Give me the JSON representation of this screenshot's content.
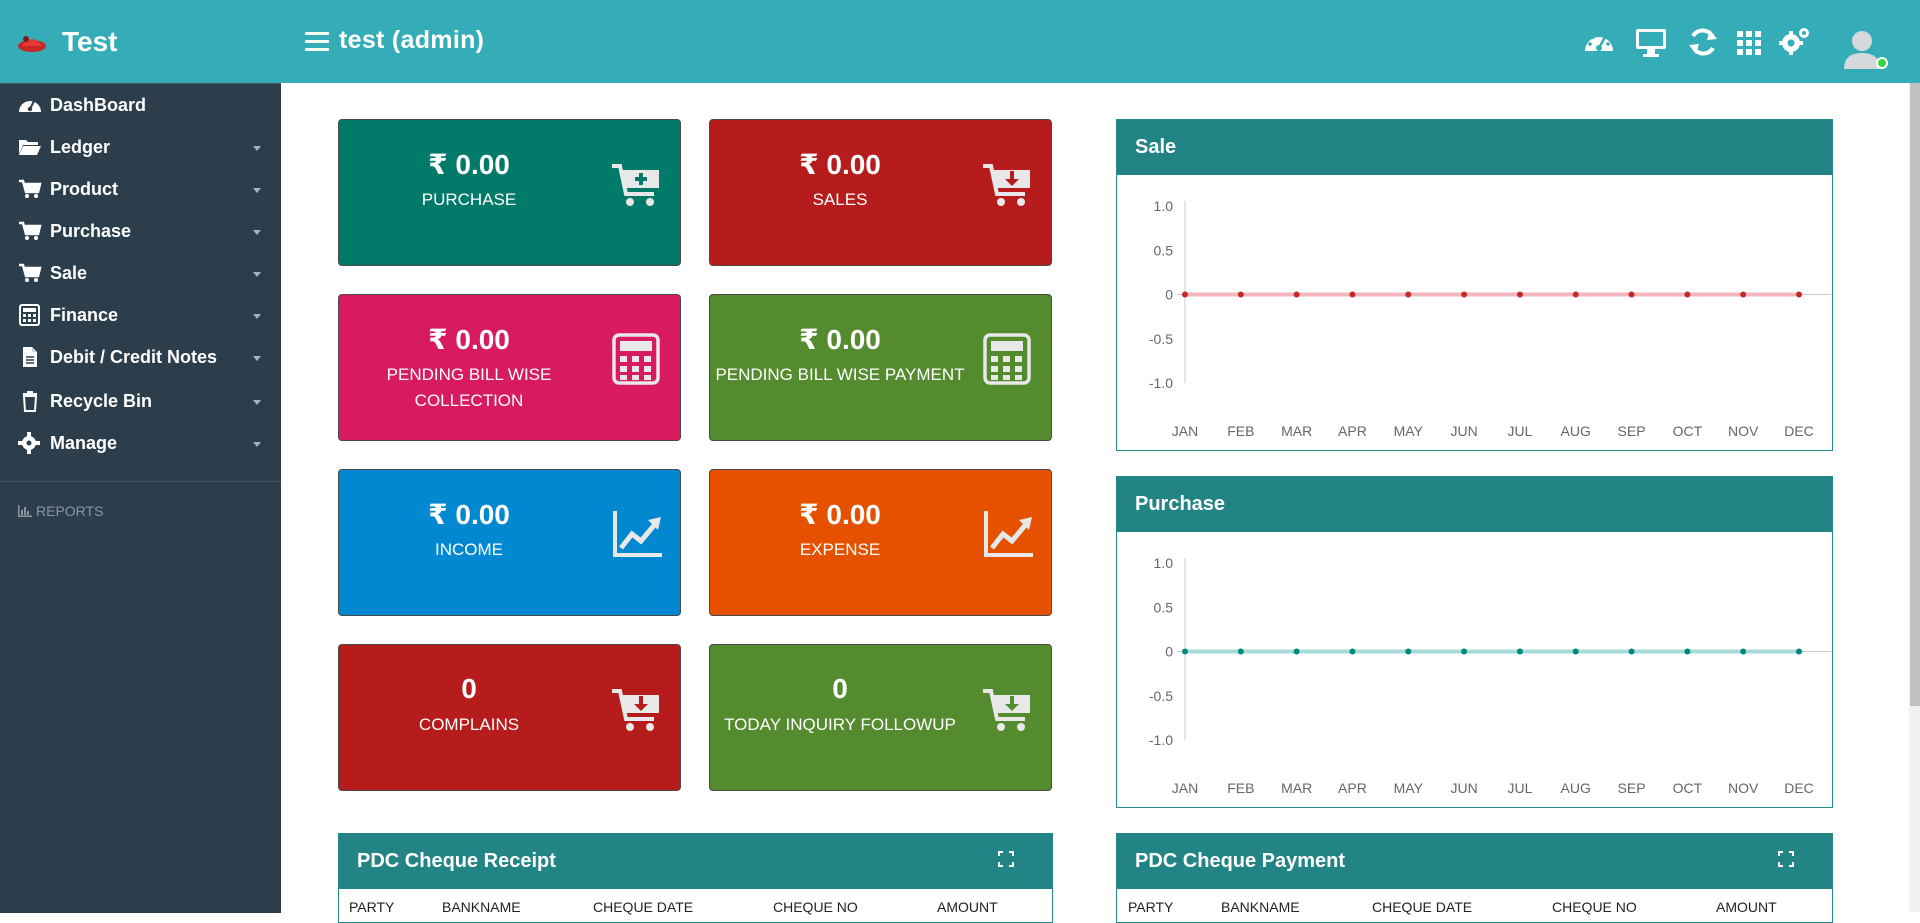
{
  "header": {
    "brand": "Test",
    "title": "test (admin)",
    "icons": [
      "dashboard-icon",
      "monitor-icon",
      "refresh-icon",
      "apps-grid-icon",
      "settings-icon",
      "user-avatar"
    ]
  },
  "sidebar": {
    "items": [
      {
        "label": "DashBoard",
        "icon": "dashboard-icon"
      },
      {
        "label": "Ledger",
        "icon": "folder-open-icon"
      },
      {
        "label": "Product",
        "icon": "cart-icon"
      },
      {
        "label": "Purchase",
        "icon": "cart-plus-icon"
      },
      {
        "label": "Sale",
        "icon": "cart-arrow-icon"
      },
      {
        "label": "Finance",
        "icon": "calculator-icon"
      },
      {
        "label": "Debit / Credit Notes",
        "icon": "document-icon"
      },
      {
        "label": "Recycle Bin",
        "icon": "trash-icon"
      },
      {
        "label": "Manage",
        "icon": "gear-icon"
      }
    ],
    "section_label": "REPORTS"
  },
  "cards": [
    {
      "amount": "₹ 0.00",
      "label": "PURCHASE",
      "color": "#027a6a",
      "icon": "cart-plus-icon"
    },
    {
      "amount": "₹ 0.00",
      "label": "SALES",
      "color": "#b71c1c",
      "icon": "cart-download-icon"
    },
    {
      "amount": "₹ 0.00",
      "label": "PENDING BILL WISE COLLECTION",
      "color": "#d81b60",
      "icon": "calculator-icon"
    },
    {
      "amount": "₹ 0.00",
      "label": "PENDING BILL WISE PAYMENT",
      "color": "#558b2f",
      "icon": "calculator-icon"
    },
    {
      "amount": "₹ 0.00",
      "label": "INCOME",
      "color": "#0288d1",
      "icon": "line-chart-icon"
    },
    {
      "amount": "₹ 0.00",
      "label": "EXPENSE",
      "color": "#e65100",
      "icon": "line-chart-icon"
    },
    {
      "amount": "0",
      "label": "COMPLAINS",
      "color": "#b71c1c",
      "icon": "cart-download-icon"
    },
    {
      "amount": "0",
      "label": "TODAY INQUIRY FOLLOWUP",
      "color": "#558b2f",
      "icon": "cart-download-icon"
    }
  ],
  "panels": {
    "sale_title": "Sale",
    "purchase_title": "Purchase",
    "pdc_receipt_title": "PDC Cheque Receipt",
    "pdc_payment_title": "PDC Cheque Payment"
  },
  "table_columns": [
    "PARTY",
    "BANKNAME",
    "CHEQUE DATE",
    "CHEQUE NO",
    "AMOUNT"
  ],
  "chart_data": [
    {
      "type": "line",
      "title": "Sale",
      "categories": [
        "JAN",
        "FEB",
        "MAR",
        "APR",
        "MAY",
        "JUN",
        "JUL",
        "AUG",
        "SEP",
        "OCT",
        "NOV",
        "DEC"
      ],
      "values": [
        0,
        0,
        0,
        0,
        0,
        0,
        0,
        0,
        0,
        0,
        0,
        0
      ],
      "ylim": [
        -1.0,
        1.0
      ],
      "yticks": [
        "1.0",
        "0.5",
        "0",
        "-0.5",
        "-1.0"
      ],
      "line_color": "#f4b6bd",
      "point_color": "#c62828",
      "grid": false
    },
    {
      "type": "line",
      "title": "Purchase",
      "categories": [
        "JAN",
        "FEB",
        "MAR",
        "APR",
        "MAY",
        "JUN",
        "JUL",
        "AUG",
        "SEP",
        "OCT",
        "NOV",
        "DEC"
      ],
      "values": [
        0,
        0,
        0,
        0,
        0,
        0,
        0,
        0,
        0,
        0,
        0,
        0
      ],
      "ylim": [
        -1.0,
        1.0
      ],
      "yticks": [
        "1.0",
        "0.5",
        "0",
        "-0.5",
        "-1.0"
      ],
      "line_color": "#a7dcd6",
      "point_color": "#00897b",
      "grid": false
    }
  ]
}
